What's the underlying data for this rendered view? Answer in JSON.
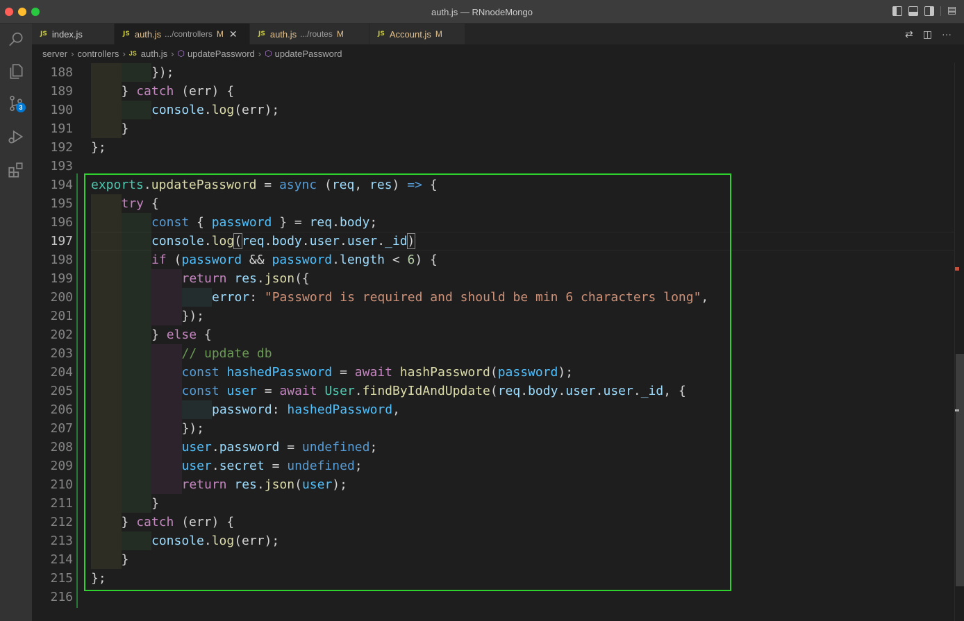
{
  "window": {
    "title": "auth.js — RNnodeMongo"
  },
  "activity": {
    "scm_badge": "3"
  },
  "tabs": [
    {
      "name": "index.js",
      "path": "",
      "badge": "",
      "active": false
    },
    {
      "name": "auth.js",
      "path": ".../controllers",
      "badge": "M",
      "active": true,
      "close": "✕"
    },
    {
      "name": "auth.js",
      "path": ".../routes",
      "badge": "M",
      "active": false
    },
    {
      "name": "Account.js",
      "path": "",
      "badge": "M",
      "active": false
    }
  ],
  "breadcrumb": [
    "server",
    "controllers",
    "auth.js",
    "updatePassword",
    "updatePassword"
  ],
  "editor": {
    "active_line": "197",
    "lines": [
      {
        "n": "188"
      },
      {
        "n": "189"
      },
      {
        "n": "190"
      },
      {
        "n": "191"
      },
      {
        "n": "192"
      },
      {
        "n": "193"
      },
      {
        "n": "194"
      },
      {
        "n": "195"
      },
      {
        "n": "196"
      },
      {
        "n": "197"
      },
      {
        "n": "198"
      },
      {
        "n": "199"
      },
      {
        "n": "200"
      },
      {
        "n": "201"
      },
      {
        "n": "202"
      },
      {
        "n": "203"
      },
      {
        "n": "204"
      },
      {
        "n": "205"
      },
      {
        "n": "206"
      },
      {
        "n": "207"
      },
      {
        "n": "208"
      },
      {
        "n": "209"
      },
      {
        "n": "210"
      },
      {
        "n": "211"
      },
      {
        "n": "212"
      },
      {
        "n": "213"
      },
      {
        "n": "214"
      },
      {
        "n": "215"
      },
      {
        "n": "216"
      }
    ],
    "code": {
      "l188": "});",
      "l189_a": "} ",
      "l189_b": "catch",
      "l189_c": " (err) {",
      "l190_a": "console",
      "l190_b": ".",
      "l190_c": "log",
      "l190_d": "(err);",
      "l191": "}",
      "l192": "};",
      "l194_a": "exports",
      "l194_b": ".",
      "l194_c": "updatePassword",
      "l194_d": " = ",
      "l194_e": "async",
      "l194_f": " (",
      "l194_g": "req",
      "l194_h": ", ",
      "l194_i": "res",
      "l194_j": ") ",
      "l194_k": "=>",
      "l194_l": " {",
      "l195_a": "try",
      "l195_b": " {",
      "l196_a": "const",
      "l196_b": " { ",
      "l196_c": "password",
      "l196_d": " } = ",
      "l196_e": "req",
      "l196_f": ".",
      "l196_g": "body",
      "l196_h": ";",
      "l197_a": "console",
      "l197_b": ".",
      "l197_c": "log",
      "l197_d": "(",
      "l197_e": "req",
      "l197_f": ".",
      "l197_g": "body",
      "l197_h": ".",
      "l197_i": "user",
      "l197_j": ".",
      "l197_k": "user",
      "l197_l": ".",
      "l197_m": "_id",
      "l197_n": ")",
      "l198_a": "if",
      "l198_b": " (",
      "l198_c": "password",
      "l198_d": " && ",
      "l198_e": "password",
      "l198_f": ".",
      "l198_g": "length",
      "l198_h": " < ",
      "l198_i": "6",
      "l198_j": ") {",
      "l199_a": "return",
      "l199_b": " ",
      "l199_c": "res",
      "l199_d": ".",
      "l199_e": "json",
      "l199_f": "({",
      "l200_a": "error",
      "l200_b": ": ",
      "l200_c": "\"Password is required and should be min 6 characters long\"",
      "l200_d": ",",
      "l201": "});",
      "l202_a": "} ",
      "l202_b": "else",
      "l202_c": " {",
      "l203": "// update db",
      "l204_a": "const",
      "l204_b": " ",
      "l204_c": "hashedPassword",
      "l204_d": " = ",
      "l204_e": "await",
      "l204_f": " ",
      "l204_g": "hashPassword",
      "l204_h": "(",
      "l204_i": "password",
      "l204_j": ");",
      "l205_a": "const",
      "l205_b": " ",
      "l205_c": "user",
      "l205_d": " = ",
      "l205_e": "await",
      "l205_f": " ",
      "l205_g": "User",
      "l205_h": ".",
      "l205_i": "findByIdAndUpdate",
      "l205_j": "(",
      "l205_k": "req",
      "l205_l": ".",
      "l205_m": "body",
      "l205_n": ".",
      "l205_o": "user",
      "l205_p": ".",
      "l205_q": "user",
      "l205_r": ".",
      "l205_s": "_id",
      "l205_t": ", {",
      "l206_a": "password",
      "l206_b": ": ",
      "l206_c": "hashedPassword",
      "l206_d": ",",
      "l207": "});",
      "l208_a": "user",
      "l208_b": ".",
      "l208_c": "password",
      "l208_d": " = ",
      "l208_e": "undefined",
      "l208_f": ";",
      "l209_a": "user",
      "l209_b": ".",
      "l209_c": "secret",
      "l209_d": " = ",
      "l209_e": "undefined",
      "l209_f": ";",
      "l210_a": "return",
      "l210_b": " ",
      "l210_c": "res",
      "l210_d": ".",
      "l210_e": "json",
      "l210_f": "(",
      "l210_g": "user",
      "l210_h": ");",
      "l211": "}",
      "l212_a": "} ",
      "l212_b": "catch",
      "l212_c": " (err) {",
      "l213_a": "console",
      "l213_b": ".",
      "l213_c": "log",
      "l213_d": "(err);",
      "l214": "}",
      "l215": "};"
    }
  },
  "colors": {
    "highlight_box": "#2fd12f",
    "accent": "#0078d4"
  }
}
